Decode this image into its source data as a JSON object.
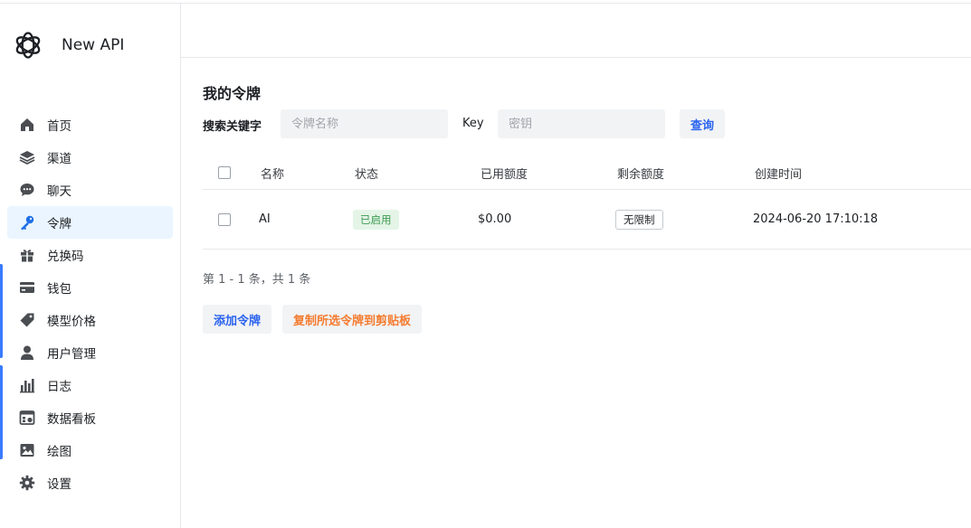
{
  "app": {
    "brand": "New API"
  },
  "sidebar": {
    "items": [
      {
        "label": "首页",
        "icon": "home-icon"
      },
      {
        "label": "渠道",
        "icon": "layers-icon"
      },
      {
        "label": "聊天",
        "icon": "chat-icon"
      },
      {
        "label": "令牌",
        "icon": "key-icon",
        "active": true
      },
      {
        "label": "兑换码",
        "icon": "gift-icon"
      },
      {
        "label": "钱包",
        "icon": "credit-card-icon"
      },
      {
        "label": "模型价格",
        "icon": "price-tag-icon"
      },
      {
        "label": "用户管理",
        "icon": "user-icon"
      },
      {
        "label": "日志",
        "icon": "bar-chart-icon"
      },
      {
        "label": "数据看板",
        "icon": "dashboard-icon"
      },
      {
        "label": "绘图",
        "icon": "image-icon"
      },
      {
        "label": "设置",
        "icon": "gear-icon"
      }
    ]
  },
  "main": {
    "title": "我的令牌",
    "search": {
      "label": "搜索关键字",
      "name_placeholder": "令牌名称",
      "key_label": "Key",
      "key_placeholder": "密钥",
      "query_button": "查询"
    },
    "table": {
      "columns": [
        "名称",
        "状态",
        "已用额度",
        "剩余额度",
        "创建时间"
      ],
      "rows": [
        {
          "name": "AI",
          "status": "已启用",
          "used": "$0.00",
          "remaining": "无限制",
          "created": "2024-06-20 17:10:18"
        }
      ]
    },
    "pagination": "第 1 - 1 条，共 1 条",
    "actions": {
      "add": "添加令牌",
      "copy": "复制所选令牌到剪贴板"
    }
  },
  "colors": {
    "accent": "#2a63ef",
    "active_nav_bg": "#eaf5ff",
    "orange": "#f47c30",
    "status_green": "#3a9a50"
  }
}
